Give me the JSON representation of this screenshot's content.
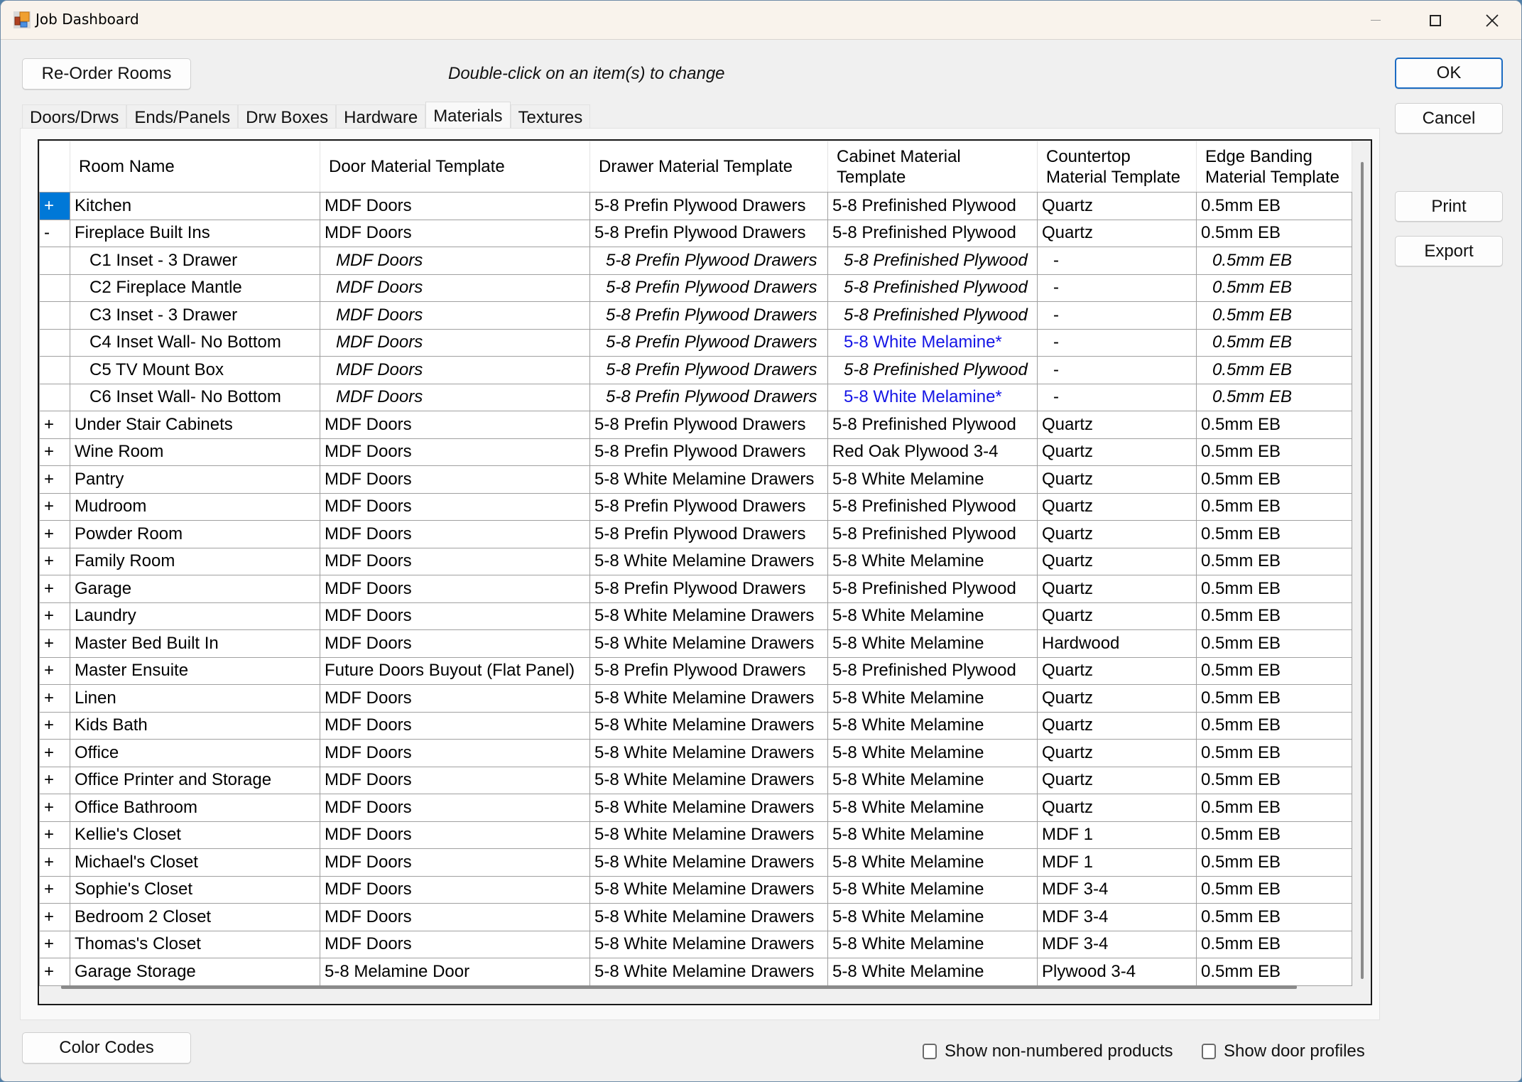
{
  "window": {
    "title": "Job Dashboard",
    "controls": [
      "minimize",
      "maximize",
      "close"
    ]
  },
  "toolbar": {
    "reorder_label": "Re-Order Rooms",
    "hint": "Double-click on an item(s) to change"
  },
  "side_buttons": {
    "ok": "OK",
    "cancel": "Cancel",
    "print": "Print",
    "export": "Export"
  },
  "tabs": [
    {
      "label": "Doors/Drws",
      "active": false
    },
    {
      "label": "Ends/Panels",
      "active": false
    },
    {
      "label": "Drw Boxes",
      "active": false
    },
    {
      "label": "Hardware",
      "active": false
    },
    {
      "label": "Materials",
      "active": true
    },
    {
      "label": "Textures",
      "active": false
    }
  ],
  "grid": {
    "columns": [
      "",
      "Room Name",
      "Door Material Template",
      "Drawer Material Template",
      "Cabinet Material Template",
      "Countertop Material Template",
      "Edge Banding Material Template"
    ],
    "column_headers_wrapped": [
      "",
      "Room Name",
      "Door Material Template",
      "Drawer Material Template",
      "Cabinet Material\nTemplate",
      "Countertop\nMaterial Template",
      "Edge Banding\nMaterial Template"
    ],
    "highlight_color": "#1515e6",
    "selection_color": "#0078d7",
    "rows": [
      {
        "expander": "+",
        "selected": true,
        "child": false,
        "room": "Kitchen",
        "door": "MDF Doors",
        "drawer": "5-8 Prefin Plywood Drawers",
        "cabinet": "5-8 Prefinished Plywood",
        "countertop": "Quartz",
        "edge": "0.5mm EB"
      },
      {
        "expander": "-",
        "child": false,
        "room": "Fireplace Built Ins",
        "door": "MDF Doors",
        "drawer": "5-8 Prefin Plywood Drawers",
        "cabinet": "5-8 Prefinished Plywood",
        "countertop": "Quartz",
        "edge": "0.5mm EB"
      },
      {
        "expander": "",
        "child": true,
        "room": "C1 Inset - 3 Drawer",
        "door": "MDF Doors",
        "drawer": "5-8 Prefin Plywood Drawers",
        "cabinet": "5-8 Prefinished Plywood",
        "countertop": "-",
        "edge": "0.5mm EB"
      },
      {
        "expander": "",
        "child": true,
        "room": "C2 Fireplace Mantle",
        "door": "MDF Doors",
        "drawer": "5-8 Prefin Plywood Drawers",
        "cabinet": "5-8 Prefinished Plywood",
        "countertop": "-",
        "edge": "0.5mm EB"
      },
      {
        "expander": "",
        "child": true,
        "room": "C3 Inset - 3 Drawer",
        "door": "MDF Doors",
        "drawer": "5-8 Prefin Plywood Drawers",
        "cabinet": "5-8 Prefinished Plywood",
        "countertop": "-",
        "edge": "0.5mm EB"
      },
      {
        "expander": "",
        "child": true,
        "room": "C4 Inset Wall- No Bottom",
        "door": "MDF Doors",
        "drawer": "5-8 Prefin Plywood Drawers",
        "cabinet": "5-8 White Melamine*",
        "cabinet_override": true,
        "countertop": "-",
        "edge": "0.5mm EB"
      },
      {
        "expander": "",
        "child": true,
        "room": "C5 TV Mount Box",
        "door": "MDF Doors",
        "drawer": "5-8 Prefin Plywood Drawers",
        "cabinet": "5-8 Prefinished Plywood",
        "countertop": "-",
        "edge": "0.5mm EB"
      },
      {
        "expander": "",
        "child": true,
        "room": "C6 Inset Wall- No Bottom",
        "door": "MDF Doors",
        "drawer": "5-8 Prefin Plywood Drawers",
        "cabinet": "5-8 White Melamine*",
        "cabinet_override": true,
        "countertop": "-",
        "edge": "0.5mm EB"
      },
      {
        "expander": "+",
        "child": false,
        "room": "Under Stair Cabinets",
        "door": "MDF Doors",
        "drawer": "5-8 Prefin Plywood Drawers",
        "cabinet": "5-8 Prefinished Plywood",
        "countertop": "Quartz",
        "edge": "0.5mm EB"
      },
      {
        "expander": "+",
        "child": false,
        "room": "Wine Room",
        "door": "MDF Doors",
        "drawer": "5-8 Prefin Plywood Drawers",
        "cabinet": "Red Oak Plywood 3-4",
        "countertop": "Quartz",
        "edge": "0.5mm EB"
      },
      {
        "expander": "+",
        "child": false,
        "room": "Pantry",
        "door": "MDF Doors",
        "drawer": "5-8 White Melamine Drawers",
        "cabinet": "5-8 White Melamine",
        "countertop": "Quartz",
        "edge": "0.5mm EB"
      },
      {
        "expander": "+",
        "child": false,
        "room": "Mudroom",
        "door": "MDF Doors",
        "drawer": "5-8 Prefin Plywood Drawers",
        "cabinet": "5-8 Prefinished Plywood",
        "countertop": "Quartz",
        "edge": "0.5mm EB"
      },
      {
        "expander": "+",
        "child": false,
        "room": "Powder Room",
        "door": "MDF Doors",
        "drawer": "5-8 Prefin Plywood Drawers",
        "cabinet": "5-8 Prefinished Plywood",
        "countertop": "Quartz",
        "edge": "0.5mm EB"
      },
      {
        "expander": "+",
        "child": false,
        "room": "Family Room",
        "door": "MDF Doors",
        "drawer": "5-8 White Melamine Drawers",
        "cabinet": "5-8 White Melamine",
        "countertop": "Quartz",
        "edge": "0.5mm EB"
      },
      {
        "expander": "+",
        "child": false,
        "room": "Garage",
        "door": "MDF Doors",
        "drawer": "5-8 Prefin Plywood Drawers",
        "cabinet": "5-8 Prefinished Plywood",
        "countertop": "Quartz",
        "edge": "0.5mm EB"
      },
      {
        "expander": "+",
        "child": false,
        "room": "Laundry",
        "door": "MDF Doors",
        "drawer": "5-8 White Melamine Drawers",
        "cabinet": "5-8 White Melamine",
        "countertop": "Quartz",
        "edge": "0.5mm EB"
      },
      {
        "expander": "+",
        "child": false,
        "room": "Master Bed Built In",
        "door": "MDF Doors",
        "drawer": "5-8 White Melamine Drawers",
        "cabinet": "5-8 White Melamine",
        "countertop": "Hardwood",
        "edge": "0.5mm EB"
      },
      {
        "expander": "+",
        "child": false,
        "room": "Master Ensuite",
        "door": "Future Doors Buyout (Flat Panel)",
        "drawer": "5-8 Prefin Plywood Drawers",
        "cabinet": "5-8 Prefinished Plywood",
        "countertop": "Quartz",
        "edge": "0.5mm EB"
      },
      {
        "expander": "+",
        "child": false,
        "room": "Linen",
        "door": "MDF Doors",
        "drawer": "5-8 White Melamine Drawers",
        "cabinet": "5-8 White Melamine",
        "countertop": "Quartz",
        "edge": "0.5mm EB"
      },
      {
        "expander": "+",
        "child": false,
        "room": "Kids Bath",
        "door": "MDF Doors",
        "drawer": "5-8 White Melamine Drawers",
        "cabinet": "5-8 White Melamine",
        "countertop": "Quartz",
        "edge": "0.5mm EB"
      },
      {
        "expander": "+",
        "child": false,
        "room": "Office",
        "door": "MDF Doors",
        "drawer": "5-8 White Melamine Drawers",
        "cabinet": "5-8 White Melamine",
        "countertop": "Quartz",
        "edge": "0.5mm EB"
      },
      {
        "expander": "+",
        "child": false,
        "room": "Office Printer and Storage",
        "door": "MDF Doors",
        "drawer": "5-8 White Melamine Drawers",
        "cabinet": "5-8 White Melamine",
        "countertop": "Quartz",
        "edge": "0.5mm EB"
      },
      {
        "expander": "+",
        "child": false,
        "room": "Office Bathroom",
        "door": "MDF Doors",
        "drawer": "5-8 White Melamine Drawers",
        "cabinet": "5-8 White Melamine",
        "countertop": "Quartz",
        "edge": "0.5mm EB"
      },
      {
        "expander": "+",
        "child": false,
        "room": "Kellie's Closet",
        "door": "MDF Doors",
        "drawer": "5-8 White Melamine Drawers",
        "cabinet": "5-8 White Melamine",
        "countertop": "MDF 1",
        "edge": "0.5mm EB"
      },
      {
        "expander": "+",
        "child": false,
        "room": "Michael's Closet",
        "door": "MDF Doors",
        "drawer": "5-8 White Melamine Drawers",
        "cabinet": "5-8 White Melamine",
        "countertop": "MDF 1",
        "edge": "0.5mm EB"
      },
      {
        "expander": "+",
        "child": false,
        "room": "Sophie's Closet",
        "door": "MDF Doors",
        "drawer": "5-8 White Melamine Drawers",
        "cabinet": "5-8 White Melamine",
        "countertop": "MDF 3-4",
        "edge": "0.5mm EB"
      },
      {
        "expander": "+",
        "child": false,
        "room": "Bedroom 2 Closet",
        "door": "MDF Doors",
        "drawer": "5-8 White Melamine Drawers",
        "cabinet": "5-8 White Melamine",
        "countertop": "MDF 3-4",
        "edge": "0.5mm EB"
      },
      {
        "expander": "+",
        "child": false,
        "room": "Thomas's Closet",
        "door": "MDF Doors",
        "drawer": "5-8 White Melamine Drawers",
        "cabinet": "5-8 White Melamine",
        "countertop": "MDF 3-4",
        "edge": "0.5mm EB"
      },
      {
        "expander": "+",
        "child": false,
        "room": "Garage Storage",
        "door": "5-8 Melamine Door",
        "drawer": "5-8 White Melamine Drawers",
        "cabinet": "5-8 White Melamine",
        "countertop": "Plywood 3-4",
        "edge": "0.5mm EB"
      }
    ]
  },
  "footer": {
    "color_codes_label": "Color Codes",
    "checkboxes": [
      {
        "label": "Show non-numbered products",
        "checked": false
      },
      {
        "label": "Show door profiles",
        "checked": false
      }
    ]
  }
}
